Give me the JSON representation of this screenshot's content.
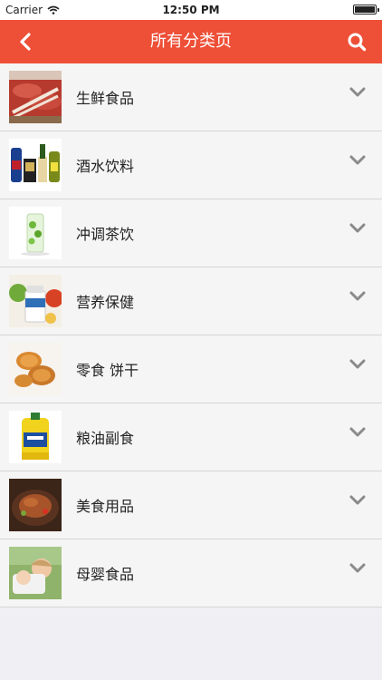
{
  "status": {
    "carrier": "Carrier",
    "time": "12:50 PM"
  },
  "nav": {
    "title": "所有分类页"
  },
  "categories": [
    {
      "label": "生鲜食品",
      "icon": "fresh-food-image"
    },
    {
      "label": "酒水饮料",
      "icon": "drinks-image"
    },
    {
      "label": "冲调茶饮",
      "icon": "tea-image"
    },
    {
      "label": "营养保健",
      "icon": "health-image"
    },
    {
      "label": "零食 饼干",
      "icon": "snack-image"
    },
    {
      "label": "粮油副食",
      "icon": "oil-image"
    },
    {
      "label": "美食用品",
      "icon": "cuisine-image"
    },
    {
      "label": "母婴食品",
      "icon": "baby-food-image"
    }
  ],
  "colors": {
    "accent": "#ee4f37",
    "background": "#efeff4"
  }
}
